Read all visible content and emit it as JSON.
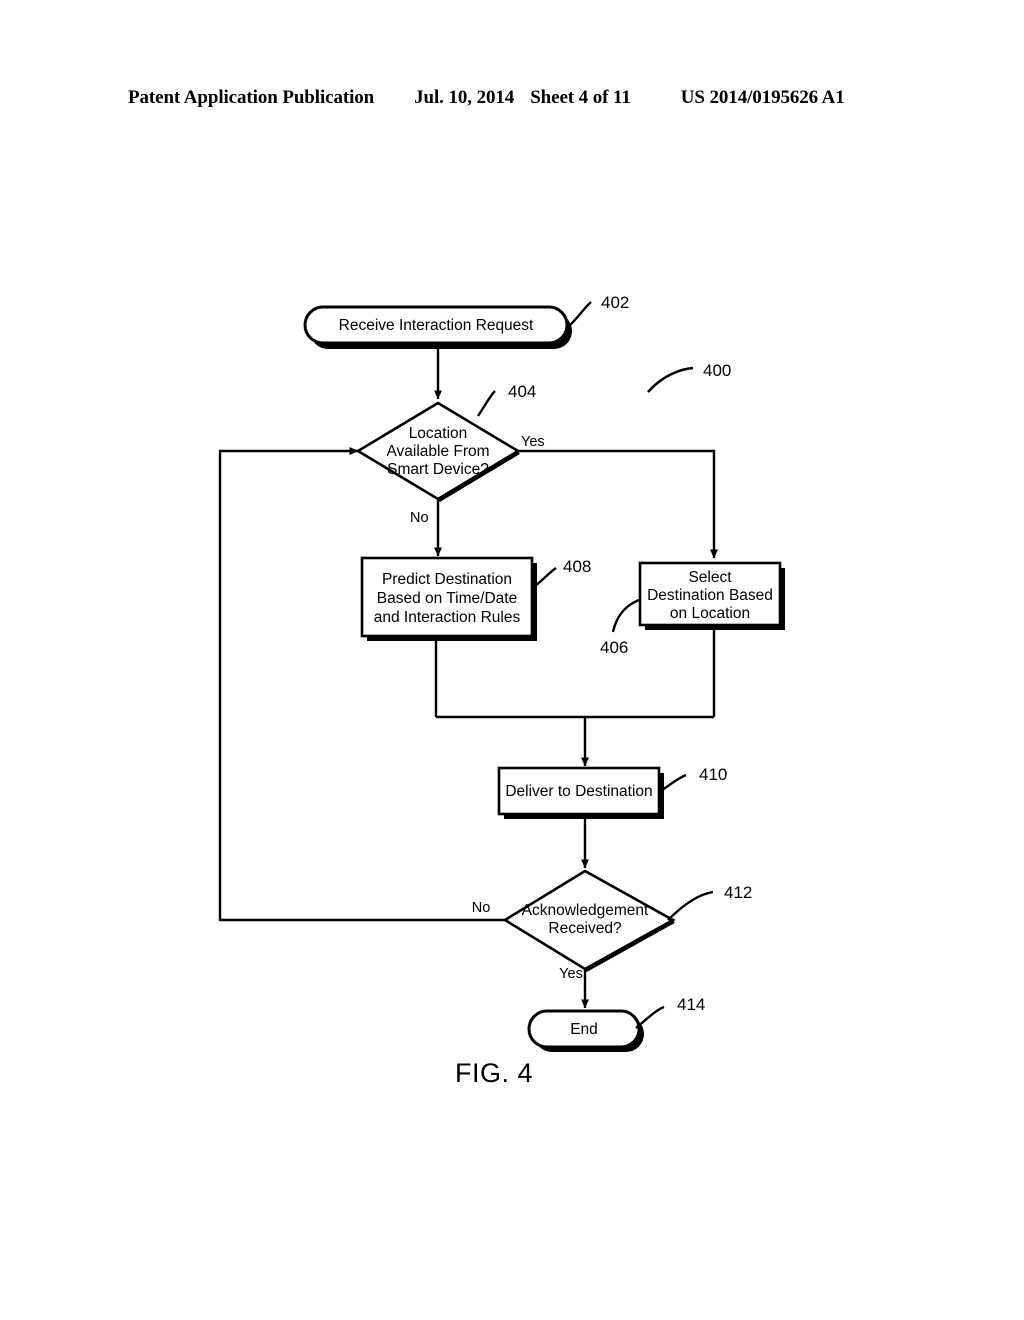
{
  "header": {
    "publication": "Patent Application Publication",
    "date": "Jul. 10, 2014",
    "sheet": "Sheet 4 of 11",
    "document_number": "US 2014/0195626 A1"
  },
  "figure": {
    "caption": "FIG. 4",
    "diagram_reference": "400",
    "nodes": [
      {
        "id": "start",
        "ref": "402",
        "shape": "rounded-rectangle",
        "text": "Receive Interaction Request"
      },
      {
        "id": "decision_location",
        "ref": "404",
        "shape": "diamond",
        "line1": "Location",
        "line2": "Available From",
        "line3": "Smart Device?"
      },
      {
        "id": "predict",
        "ref": "408",
        "shape": "rectangle",
        "line1": "Predict Destination",
        "line2": "Based on Time/Date",
        "line3": "and Interaction Rules"
      },
      {
        "id": "select",
        "ref": "406",
        "shape": "rectangle",
        "line1": "Select",
        "line2": "Destination Based",
        "line3": "on Location"
      },
      {
        "id": "deliver",
        "ref": "410",
        "shape": "rectangle",
        "text": "Deliver to Destination"
      },
      {
        "id": "decision_ack",
        "ref": "412",
        "shape": "diamond",
        "line1": "Acknowledgement",
        "line2": "Received?"
      },
      {
        "id": "end",
        "ref": "414",
        "shape": "rounded-rectangle",
        "text": "End"
      }
    ],
    "edge_labels": {
      "location_yes": "Yes",
      "location_no": "No",
      "ack_no": "No",
      "ack_yes": "Yes"
    },
    "colors": {
      "stroke": "#000000",
      "fill": "#ffffff",
      "page_background": "#ffffff"
    }
  }
}
